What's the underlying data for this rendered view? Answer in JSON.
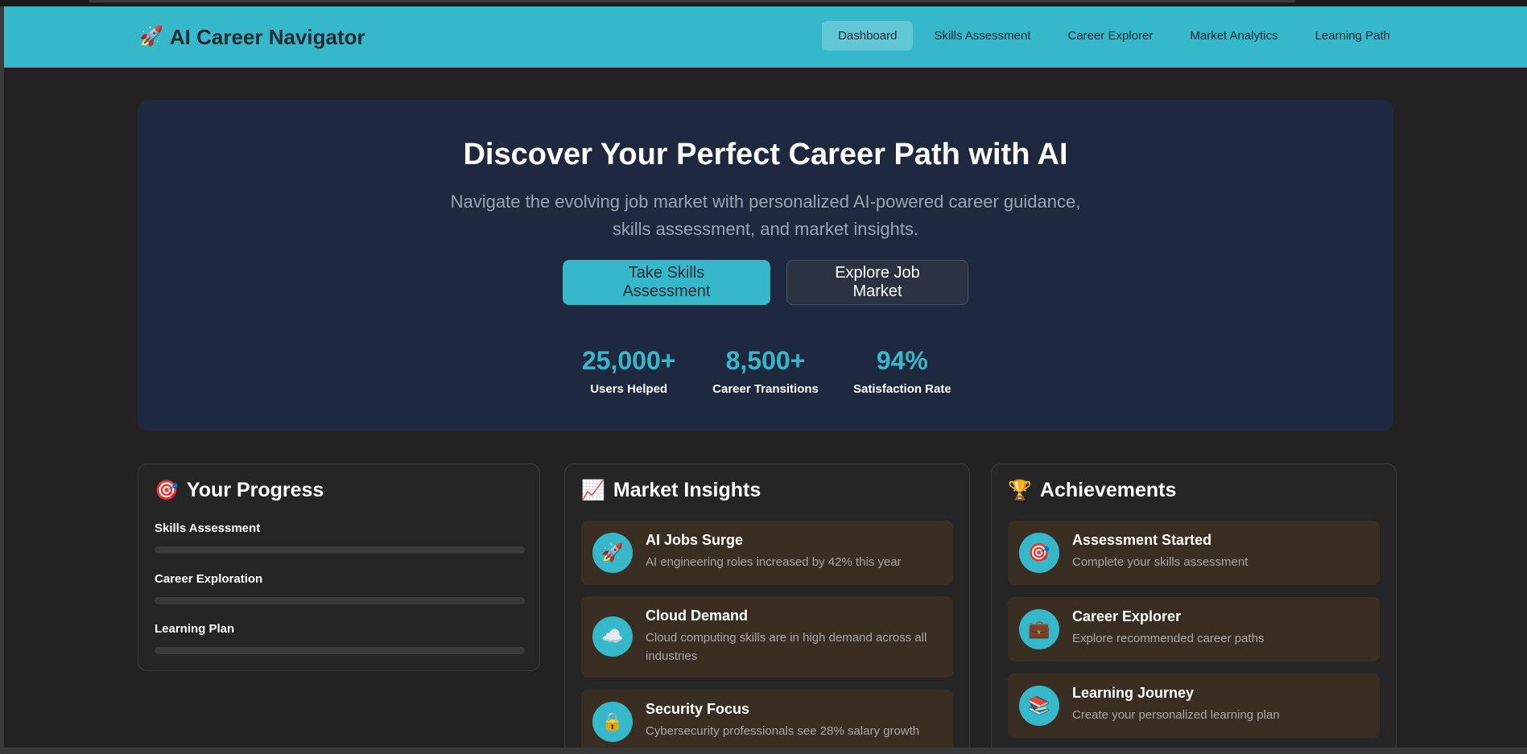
{
  "header": {
    "logo_icon": "🚀",
    "logo_text": "AI Career Navigator",
    "nav": [
      {
        "label": "Dashboard",
        "active": true
      },
      {
        "label": "Skills Assessment",
        "active": false
      },
      {
        "label": "Career Explorer",
        "active": false
      },
      {
        "label": "Market Analytics",
        "active": false
      },
      {
        "label": "Learning Path",
        "active": false
      }
    ]
  },
  "hero": {
    "title": "Discover Your Perfect Career Path with AI",
    "subtitle": "Navigate the evolving job market with personalized AI-powered career guidance, skills assessment, and market insights.",
    "primary_button": "Take Skills Assessment",
    "secondary_button": "Explore Job Market",
    "stats": [
      {
        "value": "25,000+",
        "label": "Users Helped"
      },
      {
        "value": "8,500+",
        "label": "Career Transitions"
      },
      {
        "value": "94%",
        "label": "Satisfaction Rate"
      }
    ]
  },
  "progress": {
    "icon": "🎯",
    "title": "Your Progress",
    "items": [
      {
        "label": "Skills Assessment",
        "value": 0
      },
      {
        "label": "Career Exploration",
        "value": 0
      },
      {
        "label": "Learning Plan",
        "value": 0
      }
    ]
  },
  "insights": {
    "icon": "📈",
    "title": "Market Insights",
    "items": [
      {
        "icon": "🚀",
        "title": "AI Jobs Surge",
        "desc": "AI engineering roles increased by 42% this year"
      },
      {
        "icon": "☁️",
        "title": "Cloud Demand",
        "desc": "Cloud computing skills are in high demand across all industries"
      },
      {
        "icon": "🔒",
        "title": "Security Focus",
        "desc": "Cybersecurity professionals see 28% salary growth"
      }
    ]
  },
  "achievements": {
    "icon": "🏆",
    "title": "Achievements",
    "items": [
      {
        "icon": "🎯",
        "title": "Assessment Started",
        "desc": "Complete your skills assessment"
      },
      {
        "icon": "💼",
        "title": "Career Explorer",
        "desc": "Explore recommended career paths"
      },
      {
        "icon": "📚",
        "title": "Learning Journey",
        "desc": "Create your personalized learning plan"
      }
    ]
  },
  "colors": {
    "accent": "#35b8c9",
    "hero_bg": "#1e2940",
    "page_bg": "#212221",
    "item_bg": "#3a2e22"
  }
}
